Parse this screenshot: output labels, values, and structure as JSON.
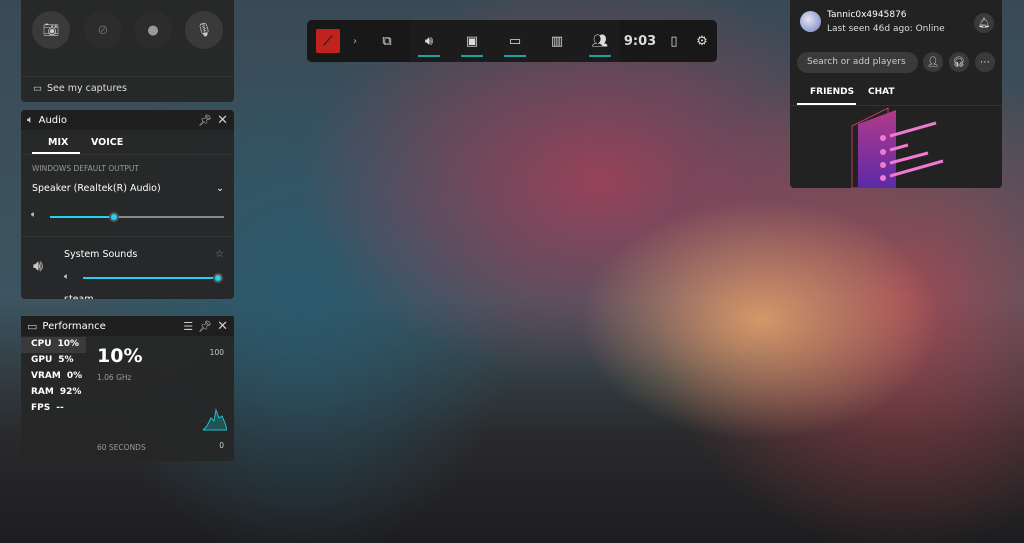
{
  "capture": {
    "buttons": [
      "camera-icon",
      "record-last-icon",
      "record-dot-icon",
      "microphone-icon"
    ],
    "see_captures": "See my captures"
  },
  "audio": {
    "title": "Audio",
    "tabs": [
      "MIX",
      "VOICE"
    ],
    "section": "WINDOWS DEFAULT OUTPUT",
    "device": "Speaker (Realtek(R) Audio)",
    "master_volume_pct": 37,
    "apps": [
      {
        "name": "System Sounds",
        "volume_pct": 100
      },
      {
        "name": "steam"
      }
    ]
  },
  "performance": {
    "title": "Performance",
    "metrics": [
      {
        "label": "CPU",
        "value": "10%"
      },
      {
        "label": "GPU",
        "value": "5%"
      },
      {
        "label": "VRAM",
        "value": "0%"
      },
      {
        "label": "RAM",
        "value": "92%"
      },
      {
        "label": "FPS",
        "value": "--"
      }
    ],
    "big_value": "10%",
    "sub": "1.06 GHz",
    "ymax": "100",
    "ymin": "0",
    "xlabel": "60 SECONDS"
  },
  "gamebar": {
    "time": "9:03",
    "accent": "#1aa3a8"
  },
  "social": {
    "username": "Tannic0x4945876",
    "status": "Last seen 46d ago: Online",
    "search_placeholder": "Search or add players",
    "tabs": [
      "FRIENDS",
      "CHAT"
    ]
  }
}
